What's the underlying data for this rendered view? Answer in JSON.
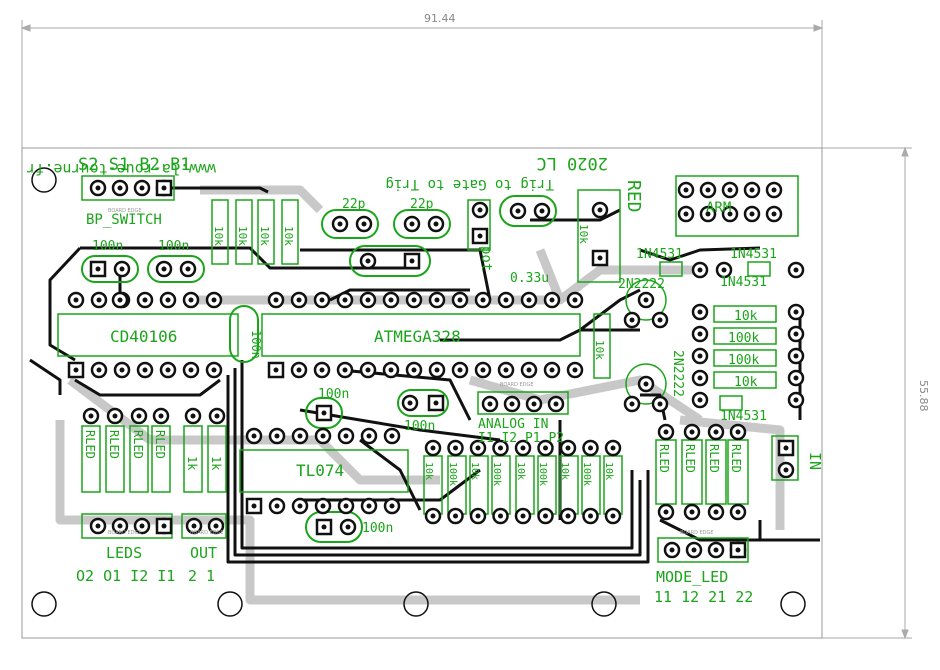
{
  "dimensions": {
    "width": "91.44",
    "height": "55.88"
  },
  "header_left": "S2 S1 B2 B1",
  "url_text": "www.la-roue-tourne.fr",
  "year_text": "2020 LC",
  "trig_text": "Trig to Gate to Trig",
  "bp_switch": "BP_SWITCH",
  "board_edge": "BOARD EDGE",
  "caps": {
    "c100n_a": "100n",
    "c100n_b": "100n",
    "c22p_a": "22p",
    "c22p_b": "22p",
    "c033u": "0.33u",
    "c100n_c": "100n",
    "c100n_d": "100n",
    "c100n_e": "100n",
    "c100n_f": "100n"
  },
  "pot_label": "pot",
  "red_label": "RED",
  "chips": {
    "cd40106": "CD40106",
    "atmega": "ATMEGA328",
    "tl074": "TL074"
  },
  "diodes": {
    "d1": "1N4531",
    "d2": "1N4531",
    "d3": "1N4531",
    "d4": "1N4531"
  },
  "transistors": {
    "t1": "2N2222",
    "t2": "2N2222"
  },
  "arm_label": "ARM",
  "right_resistors": [
    "10k",
    "100k",
    "100k",
    "10k"
  ],
  "top_resistors": [
    "10k",
    "10k",
    "10k",
    "10k"
  ],
  "analog_in": "ANALOG IN",
  "analog_pins": "I1 I2 P1 P2",
  "analog_resistors": [
    "10k",
    "100k",
    "10k",
    "100k",
    "10k",
    "100k",
    "10k",
    "100k",
    "10k"
  ],
  "rled": [
    "RLED",
    "RLED",
    "RLED",
    "RLED"
  ],
  "rled_right": [
    "RLED",
    "RLED",
    "RLED",
    "RLED"
  ],
  "out_resistors": [
    "1k",
    "1k"
  ],
  "leds_label": "LEDS",
  "leds_pins": "O2 O1 I2 I1",
  "out_label": "OUT",
  "out_pins": "2  1",
  "mode_led": "MODE_LED",
  "mode_pins": "11 12 21 22",
  "in_label": "IN",
  "r_misc": [
    "10k",
    "10k"
  ]
}
